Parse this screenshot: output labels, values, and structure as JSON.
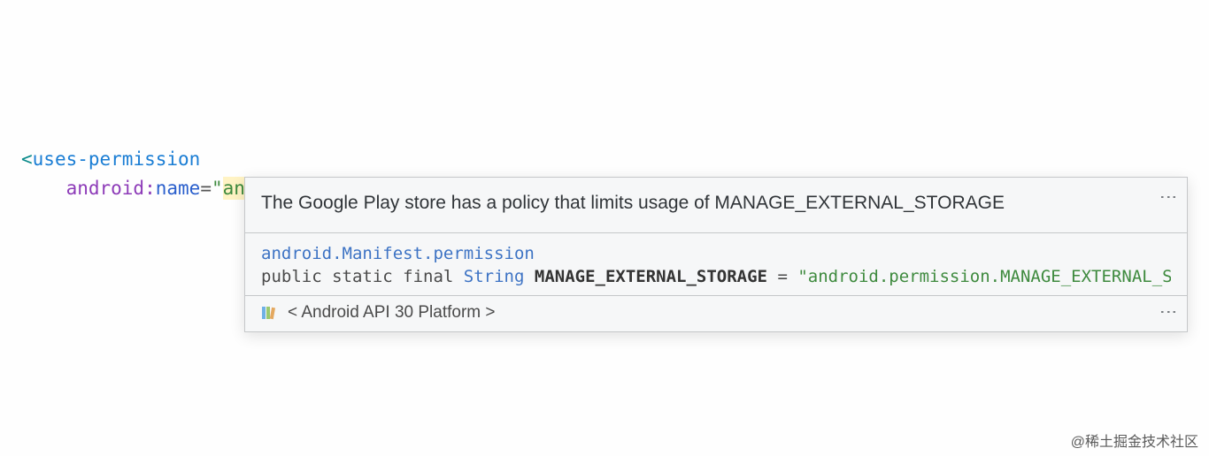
{
  "code": {
    "tag_open_bracket": "<",
    "tag_name": "uses-permission",
    "attr_prefix": "android",
    "attr_colon": ":",
    "attr_name": "name",
    "attr_eq": "=",
    "attr_quote": "\"",
    "attr_value": "android.permission.MANAGE_EXTERNAL_STORAGE",
    "tag_close": "/>"
  },
  "tooltip": {
    "lint_message": "The Google Play store has a policy that limits usage of MANAGE_EXTERNAL_STORAGE",
    "doc_class": "android.Manifest.permission",
    "decl": {
      "modifiers": "public static final",
      "type": "String",
      "name": "MANAGE_EXTERNAL_STORAGE",
      "eq": " = ",
      "value_prefix": "\"android.permission.MANAGE_EXTERNAL_ST"
    },
    "platform_label": "< Android API 30 Platform >"
  },
  "watermark": "@稀土掘金技术社区"
}
